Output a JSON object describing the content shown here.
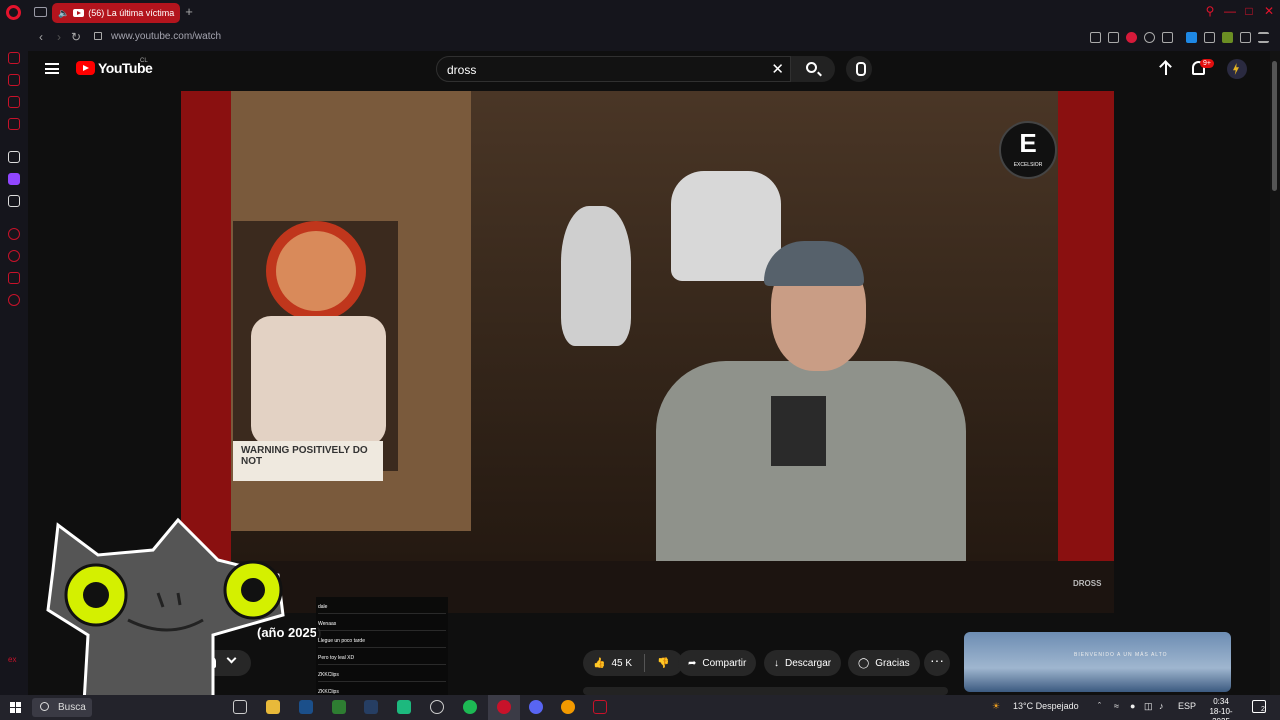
{
  "browser": {
    "tab_title": "(56) La última víctima",
    "new_tab": "+",
    "url": "www.youtube.com/watch"
  },
  "youtube": {
    "logo_text": "YouTube",
    "country_code": "CL",
    "search_query": "dross",
    "notifications_badge": "9+",
    "video_watermark": "EXCELSIOR",
    "video_watermark_letter": "E",
    "channel_watermark": "DROSS",
    "sign_text": "WARNING POSITIVELY DO NOT",
    "title_visible": "(año 2025)",
    "actions": {
      "likes": "45 K",
      "share": "Compartir",
      "download": "Descargar",
      "thanks": "Gracias",
      "more": "···"
    },
    "recommendation_ad_text": "BIENVENIDO A UN MÁS ALTO"
  },
  "chat": [
    {
      "user": "",
      "text": "dale"
    },
    {
      "user": "",
      "text": "Wenaas"
    },
    {
      "user": "",
      "text": "Llegue un poco tarde"
    },
    {
      "user": "",
      "text": "Pero toy leal XD"
    },
    {
      "user": "",
      "text": "ZKKClips"
    },
    {
      "user": "",
      "text": "ZKKClips"
    }
  ],
  "taskbar": {
    "search_label": "Busca",
    "weather": "13°C  Despejado",
    "language": "ESP",
    "time": "0:34",
    "date": "18-10-2025",
    "notification_count": "2"
  },
  "colors": {
    "opera_red": "#e3132c",
    "tab_red": "#b3141d",
    "youtube_red": "#ff0000",
    "cat_eye_yellow": "#d4f000"
  }
}
